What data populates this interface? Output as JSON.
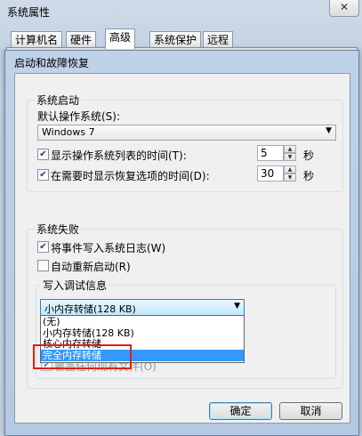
{
  "outer_window": {
    "title": "系统属性",
    "close_glyph": "✕",
    "tabs": [
      "计算机名",
      "硬件",
      "高级",
      "系统保护",
      "远程"
    ],
    "active_tab": "高级"
  },
  "dialog": {
    "title": "启动和故障恢复",
    "startup": {
      "group_label": "系统启动",
      "default_os_label": "默认操作系统(S):",
      "default_os_value": "Windows 7",
      "show_list_label": "显示操作系统列表的时间(T):",
      "show_list_checked": true,
      "show_list_value": "5",
      "show_recovery_label": "在需要时显示恢复选项的时间(D):",
      "show_recovery_checked": true,
      "show_recovery_value": "30",
      "seconds_unit": "秒"
    },
    "failure": {
      "group_label": "系统失败",
      "write_event_label": "将事件写入系统日志(W)",
      "write_event_checked": true,
      "auto_restart_label": "自动重新启动(R)",
      "auto_restart_checked": false,
      "debug_info_label": "写入调试信息",
      "debug_select_value": "小内存转储(128 KB)",
      "dropdown_options": [
        "(无)",
        "小内存转储(128 KB)",
        "核心内存转储",
        "完全内存转储"
      ],
      "dropdown_selected": "完全内存转储",
      "overwrite_label": "覆盖任何现有文件(O)",
      "overwrite_checked": true
    },
    "buttons": {
      "ok": "确定",
      "cancel": "取消"
    }
  },
  "highlight_color": "#e0201a",
  "selection_color": "#3399ff"
}
